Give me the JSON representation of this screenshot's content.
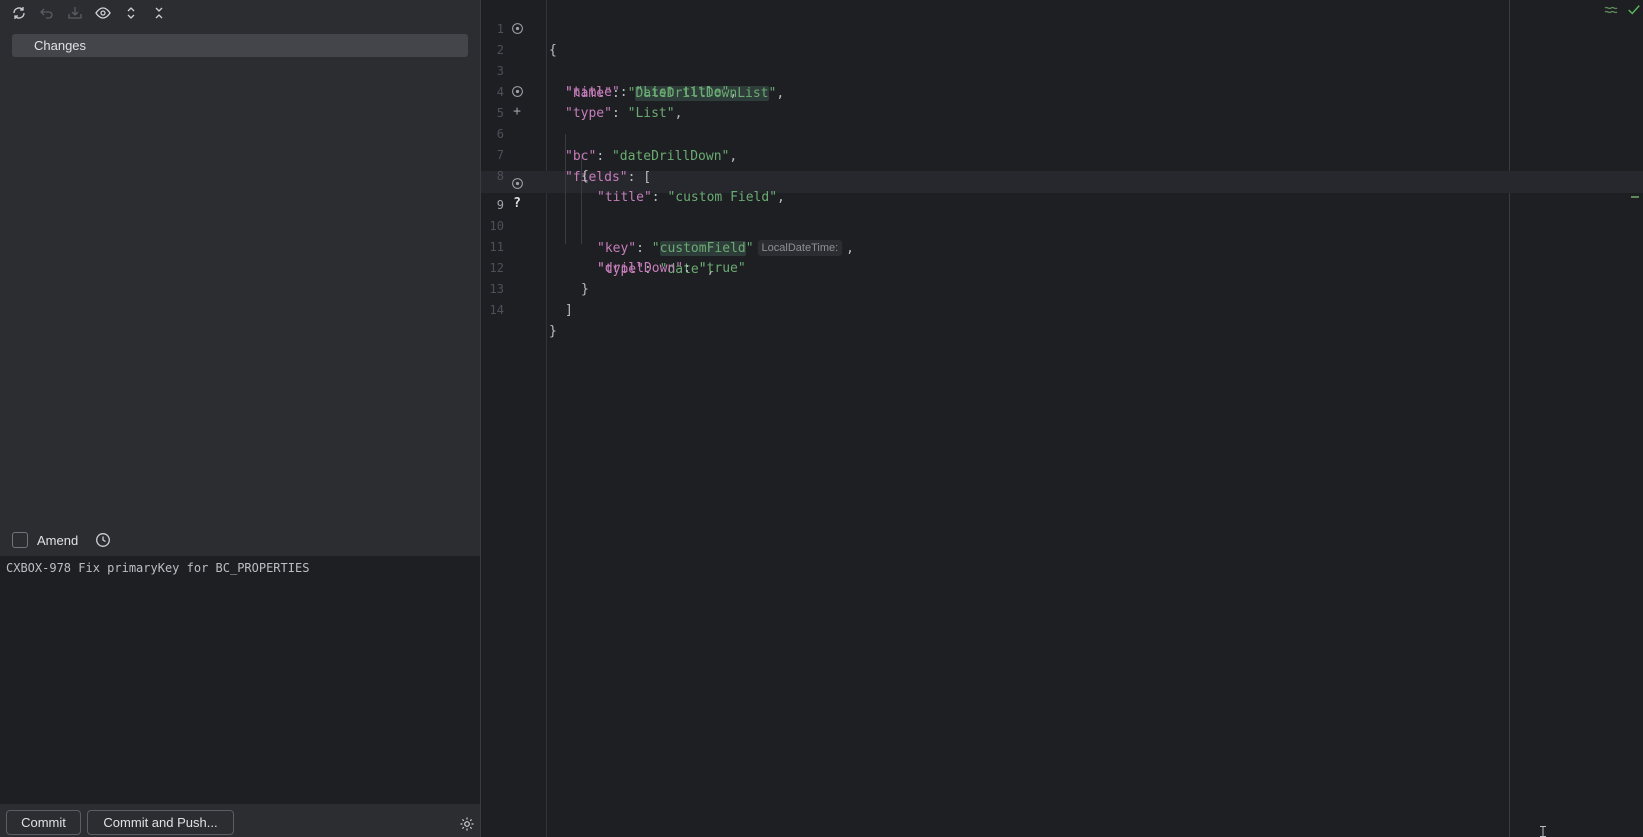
{
  "left_panel": {
    "toolbar": {
      "icons": [
        "refresh-icon",
        "rollback-icon",
        "shelve-icon",
        "eye-icon",
        "expand-all-icon",
        "collapse-all-icon"
      ]
    },
    "changes_label": "Changes",
    "amend_label": "Amend",
    "commit_message": "CXBOX-978 Fix primaryKey for BC_PROPERTIES",
    "commit_button": "Commit",
    "commit_push_button": "Commit and Push..."
  },
  "editor": {
    "lines": [
      {
        "n": "1"
      },
      {
        "n": "2",
        "key": "\"name\"",
        "value": "DateDrillDownList"
      },
      {
        "n": "3",
        "key": "\"title\"",
        "value": "\"List title\""
      },
      {
        "n": "4",
        "key": "\"type\"",
        "value": "\"List\""
      },
      {
        "n": "5",
        "key": "\"bc\"",
        "value": "\"dateDrillDown\""
      },
      {
        "n": "6",
        "key": "\"fields\""
      },
      {
        "n": "7"
      },
      {
        "n": "8",
        "key": "\"title\"",
        "value": "\"custom Field\""
      },
      {
        "n": "9",
        "key": "\"key\"",
        "value": "customField",
        "hint": "LocalDateTime:"
      },
      {
        "n": "10",
        "key": "\"type\"",
        "value": "\"date\""
      },
      {
        "n": "11",
        "key": "\"drillDown\"",
        "value": "\"true\""
      },
      {
        "n": "12"
      },
      {
        "n": "13"
      },
      {
        "n": "14"
      }
    ]
  },
  "colors": {
    "keyword": "#c77dbb",
    "string": "#6aab73",
    "accent_ok": "#5e8a5b"
  }
}
